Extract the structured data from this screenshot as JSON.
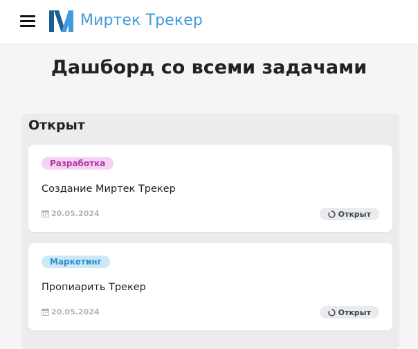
{
  "header": {
    "brand": "Миртек Трекер",
    "menu_icon": "hamburger-icon",
    "logo_icon": "mirtek-logo-icon",
    "brand_color": "#3f9bdc"
  },
  "page": {
    "title": "Дашборд со всеми задачами"
  },
  "columns": [
    {
      "title": "Открыт",
      "cards": [
        {
          "tag": "Разработка",
          "title": "Создание Миртек Трекер",
          "date": "20.05.2024",
          "date_icon": "calendar-icon",
          "status": "Открыт",
          "status_icon": "spinner-icon"
        },
        {
          "tag": "Маркетинг",
          "title": "Пропиарить Трекер",
          "date": "20.05.2024",
          "date_icon": "calendar-icon",
          "status": "Открыт",
          "status_icon": "spinner-icon"
        }
      ]
    }
  ]
}
